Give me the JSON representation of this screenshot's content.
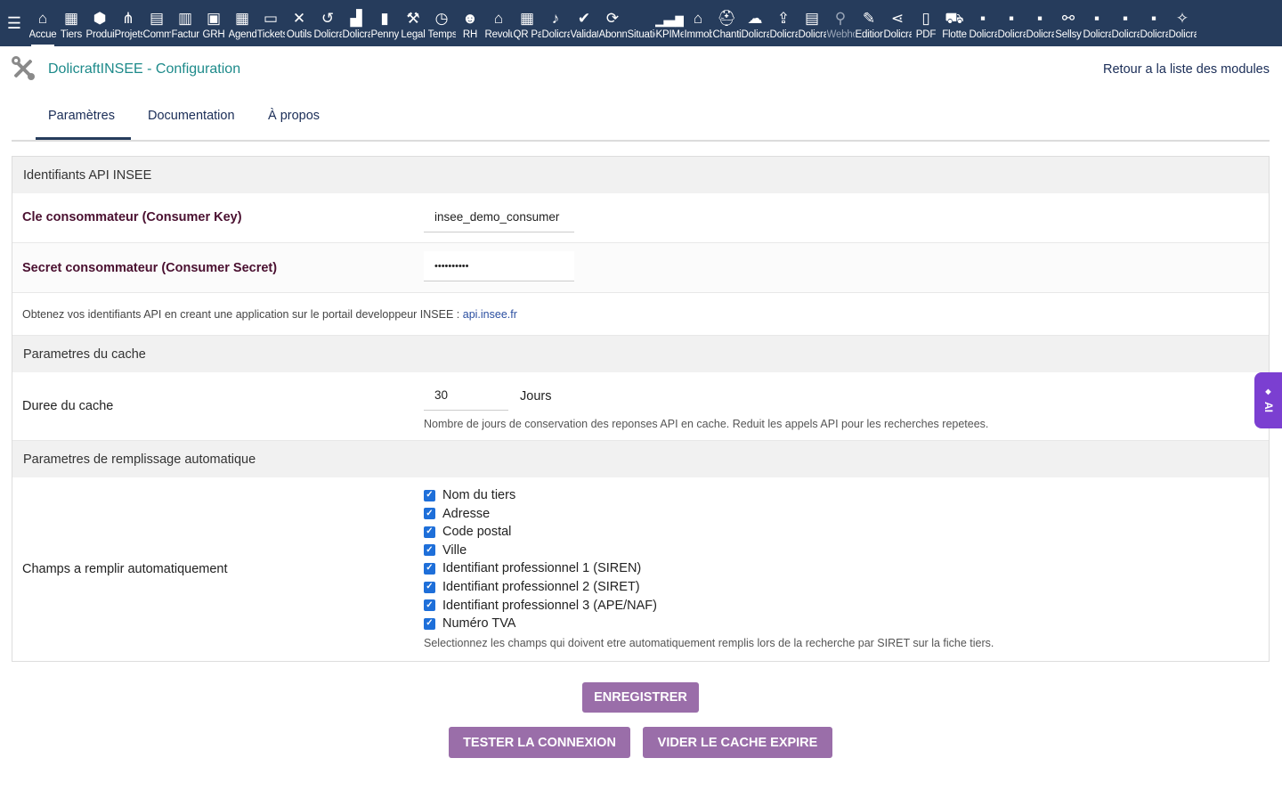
{
  "topbar": {
    "menu_items": [
      {
        "label": "Accueil",
        "icon": "⌂",
        "name": "home-icon"
      },
      {
        "label": "Tiers",
        "icon": "▦",
        "name": "building-icon"
      },
      {
        "label": "Produits",
        "icon": "⬢",
        "name": "cube-icon"
      },
      {
        "label": "Projets",
        "icon": "⋔",
        "name": "project-icon"
      },
      {
        "label": "Commercial",
        "icon": "▤",
        "name": "briefcase-icon"
      },
      {
        "label": "Facturation",
        "icon": "▥",
        "name": "invoice-icon"
      },
      {
        "label": "GRH",
        "icon": "▣",
        "name": "hrm-icon"
      },
      {
        "label": "Agenda",
        "icon": "▦",
        "name": "calendar-icon"
      },
      {
        "label": "Tickets",
        "icon": "▭",
        "name": "ticket-icon"
      },
      {
        "label": "Outils",
        "icon": "✕",
        "name": "tools-icon"
      },
      {
        "label": "Dolicraft",
        "icon": "↺",
        "name": "undo-icon"
      },
      {
        "label": "Dolicraft",
        "icon": "▟",
        "name": "toolbox-icon"
      },
      {
        "label": "Penny",
        "icon": "▮",
        "name": "penny-icon"
      },
      {
        "label": "Legal",
        "icon": "⚒",
        "name": "gavel-icon"
      },
      {
        "label": "Temps",
        "icon": "◷",
        "name": "clock-icon"
      },
      {
        "label": "RH",
        "icon": "☻",
        "name": "users-icon"
      },
      {
        "label": "Revolut",
        "icon": "⌂",
        "name": "bank-icon"
      },
      {
        "label": "QR Pay",
        "icon": "▦",
        "name": "qrcode-icon"
      },
      {
        "label": "Dolicraft",
        "icon": "♪",
        "name": "bell-icon"
      },
      {
        "label": "Validation",
        "icon": "✔",
        "name": "check-icon"
      },
      {
        "label": "Abonnements",
        "icon": "⟳",
        "name": "refresh-icon"
      },
      {
        "label": "Situations",
        "icon": " ",
        "name": "blank-icon"
      },
      {
        "label": "KPIMetrics",
        "icon": "▁▃▅",
        "name": "chart-icon"
      },
      {
        "label": "Immobilier",
        "icon": "⌂",
        "name": "house-icon"
      },
      {
        "label": "Chantiers",
        "icon": "⛑",
        "name": "helmet-icon"
      },
      {
        "label": "Dolicraft",
        "icon": "☁",
        "name": "cloud-icon"
      },
      {
        "label": "Dolicraft",
        "icon": "⇪",
        "name": "upload-icon"
      },
      {
        "label": "Dolicraft",
        "icon": "▤",
        "name": "office-icon"
      },
      {
        "label": "Webhook",
        "icon": "⚲",
        "name": "plug-icon"
      },
      {
        "label": "Edition",
        "icon": "✎",
        "name": "edit-icon"
      },
      {
        "label": "Dolicraft",
        "icon": "⋖",
        "name": "share-icon"
      },
      {
        "label": "PDF",
        "icon": "▯",
        "name": "pdf-icon"
      },
      {
        "label": "Flotte",
        "icon": "⛟",
        "name": "car-icon"
      },
      {
        "label": "Dolicraft",
        "icon": "▪",
        "name": "note-icon"
      },
      {
        "label": "Dolicraft",
        "icon": "▪",
        "name": "note-icon"
      },
      {
        "label": "Dolicraft",
        "icon": "▪",
        "name": "note-icon"
      },
      {
        "label": "Sellsy",
        "icon": "⚯",
        "name": "handshake-icon"
      },
      {
        "label": "Dolicraft",
        "icon": "▪",
        "name": "note-icon"
      },
      {
        "label": "Dolicraft",
        "icon": "▪",
        "name": "note-icon"
      },
      {
        "label": "Dolicraft",
        "icon": "▪",
        "name": "note-icon"
      },
      {
        "label": "Dolicraft",
        "icon": "✧",
        "name": "magic-icon"
      }
    ]
  },
  "header": {
    "title": "DolicraftINSEE - Configuration",
    "back_link": "Retour a la liste des modules"
  },
  "tabs": [
    "Paramètres",
    "Documentation",
    "À propos"
  ],
  "sections": {
    "api": {
      "title": "Identifiants API INSEE",
      "consumer_key_label": "Cle consommateur (Consumer Key)",
      "consumer_key_value": "insee_demo_consumer",
      "consumer_secret_label": "Secret consommateur (Consumer Secret)",
      "consumer_secret_value": "••••••••••",
      "note_text": "Obtenez vos identifiants API en creant une application sur le portail developpeur INSEE : ",
      "note_link": "api.insee.fr"
    },
    "cache": {
      "title": "Parametres du cache",
      "duration_label": "Duree du cache",
      "duration_value": "30",
      "duration_unit": "Jours",
      "duration_help": "Nombre de jours de conservation des reponses API en cache. Reduit les appels API pour les recherches repetees."
    },
    "autofill": {
      "title": "Parametres de remplissage automatique",
      "fields_label": "Champs a remplir automatiquement",
      "options": [
        "Nom du tiers",
        "Adresse",
        "Code postal",
        "Ville",
        "Identifiant professionnel 1 (SIREN)",
        "Identifiant professionnel 2 (SIRET)",
        "Identifiant professionnel 3 (APE/NAF)",
        "Numéro TVA"
      ],
      "help": "Selectionnez les champs qui doivent etre automatiquement remplis lors de la recherche par SIRET sur la fiche tiers."
    }
  },
  "buttons": {
    "save": "ENREGISTRER",
    "test": "TESTER LA CONNEXION",
    "clear_cache": "VIDER LE CACHE EXPIRE"
  },
  "ai_tab": {
    "label": "AI",
    "icon": "◆"
  }
}
